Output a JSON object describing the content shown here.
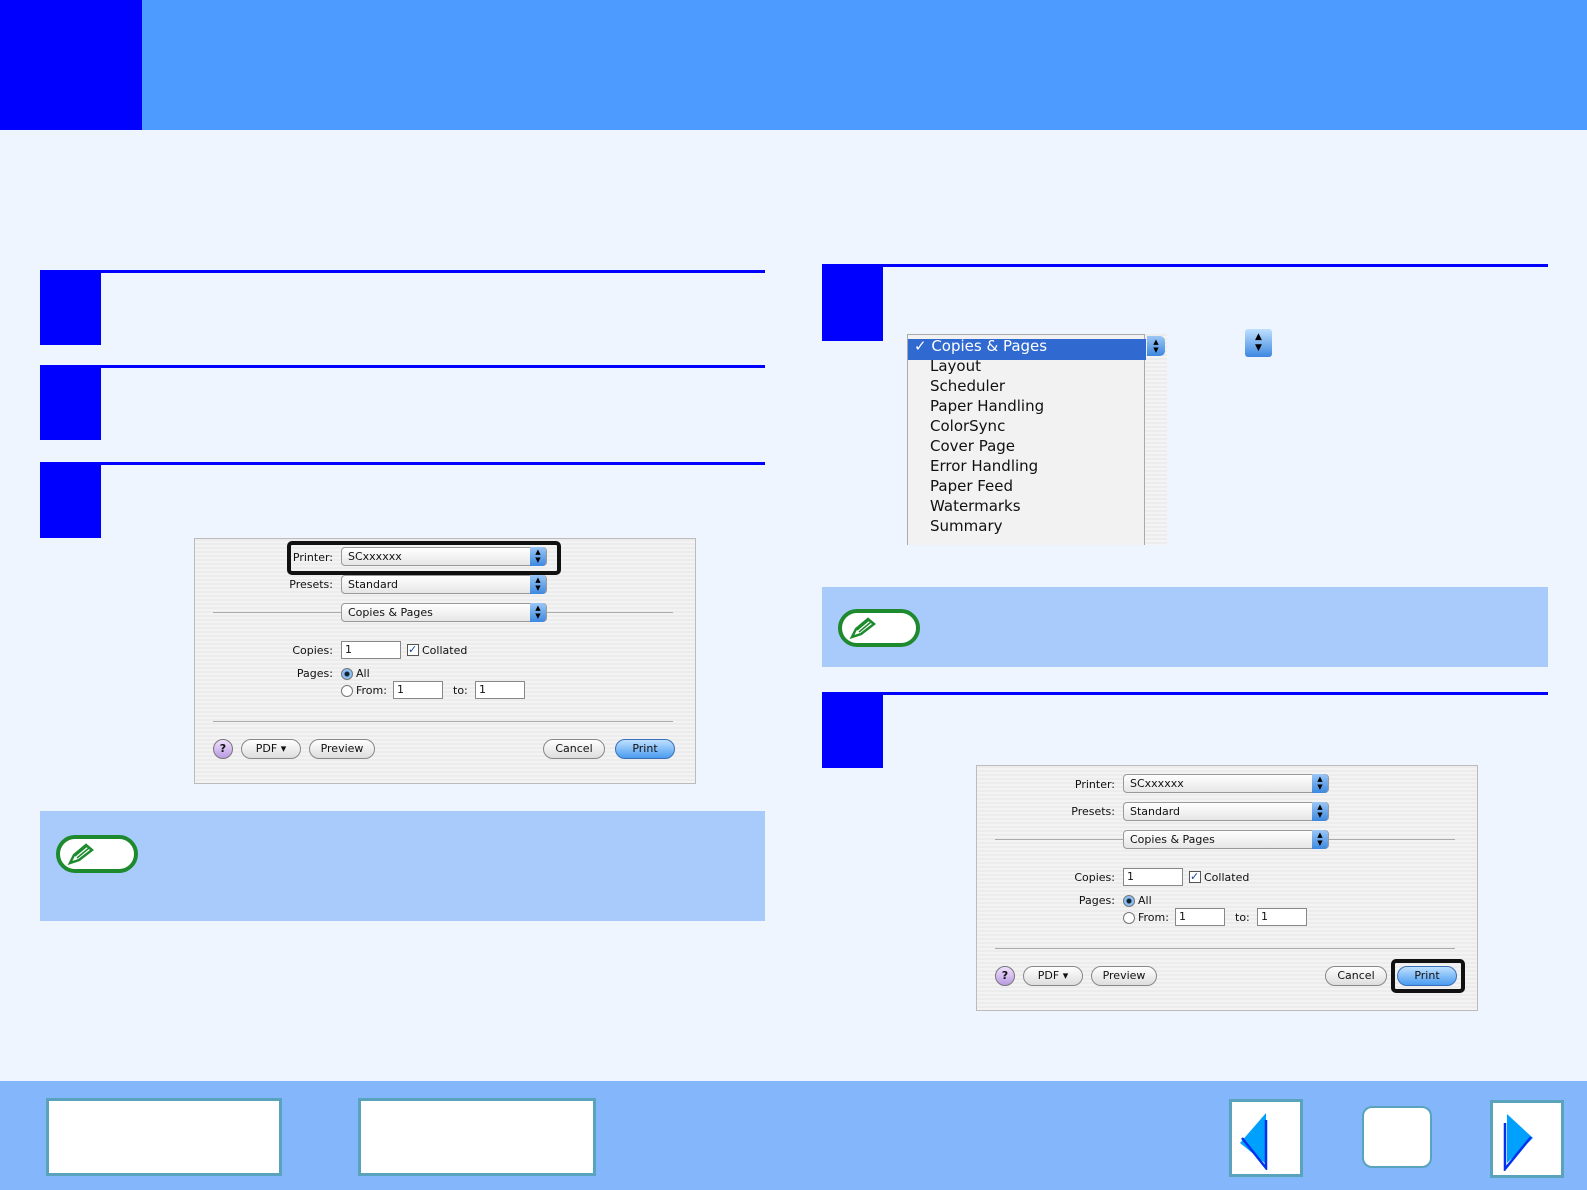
{
  "dialog": {
    "printer_label": "Printer:",
    "printer_value": "SCxxxxxx",
    "presets_label": "Presets:",
    "presets_value": "Standard",
    "panel_value": "Copies & Pages",
    "copies_label": "Copies:",
    "copies_value": "1",
    "collated_label": "Collated",
    "pages_label": "Pages:",
    "all_label": "All",
    "from_label": "From:",
    "from_value": "1",
    "to_label": "to:",
    "to_value": "1",
    "help_label": "?",
    "pdf_label": "PDF ▾",
    "preview_label": "Preview",
    "cancel_label": "Cancel",
    "print_label": "Print"
  },
  "menu": {
    "items": [
      "✓ Copies & Pages",
      "Layout",
      "Scheduler",
      "Paper Handling",
      "ColorSync",
      "Cover Page",
      "Error Handling",
      "Paper Feed",
      "Watermarks",
      "Summary"
    ],
    "stepper_glyph": "▲\n▼"
  },
  "colors": {
    "header": "#4d9bff",
    "accent": "#0000ff",
    "note_bg": "#a8cbfc",
    "footer": "#84b6fc",
    "note_icon": "#1e8a2e"
  },
  "icons": {
    "note": "pencil-icon",
    "prev": "left-arrow-icon",
    "next": "right-arrow-icon"
  }
}
